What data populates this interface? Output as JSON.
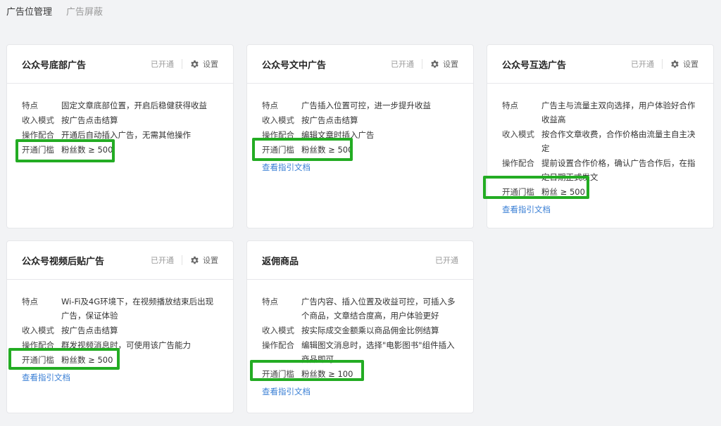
{
  "tabs": [
    {
      "label": "广告位管理"
    },
    {
      "label": "广告屏蔽"
    }
  ],
  "cards": [
    {
      "title": "公众号底部广告",
      "status": "已开通",
      "settings": "设置",
      "rows": [
        {
          "k": "特点",
          "v": "固定文章底部位置，开启后稳健获得收益"
        },
        {
          "k": "收入模式",
          "v": "按广告点击结算"
        },
        {
          "k": "操作配合",
          "v": "开通后自动插入广告，无需其他操作"
        },
        {
          "k": "开通门槛",
          "v": "粉丝数 ≥ 500"
        }
      ]
    },
    {
      "title": "公众号文中广告",
      "status": "已开通",
      "settings": "设置",
      "rows": [
        {
          "k": "特点",
          "v": "广告插入位置可控，进一步提升收益"
        },
        {
          "k": "收入模式",
          "v": "按广告点击结算"
        },
        {
          "k": "操作配合",
          "v": "编辑文章时插入广告"
        },
        {
          "k": "开通门槛",
          "v": "粉丝数 ≥ 500"
        }
      ],
      "guide": "查看指引文档"
    },
    {
      "title": "公众号互选广告",
      "status": "已开通",
      "settings": "设置",
      "rows": [
        {
          "k": "特点",
          "v": "广告主与流量主双向选择，用户体验好合作收益高"
        },
        {
          "k": "收入模式",
          "v": "按合作文章收费，合作价格由流量主自主决定"
        },
        {
          "k": "操作配合",
          "v": "提前设置合作价格，确认广告合作后，在指定日期正式发文"
        },
        {
          "k": "开通门槛",
          "v": "粉丝 ≥ 500"
        }
      ],
      "guide": "查看指引文档"
    },
    {
      "title": "公众号视频后贴广告",
      "status": "已开通",
      "settings": "设置",
      "rows": [
        {
          "k": "特点",
          "v": "Wi-Fi及4G环境下，在视频播放结束后出现广告，保证体验"
        },
        {
          "k": "收入模式",
          "v": "按广告点击结算"
        },
        {
          "k": "操作配合",
          "v": "群发视频消息时，可使用该广告能力"
        },
        {
          "k": "开通门槛",
          "v": "粉丝数 ≥ 500"
        }
      ],
      "guide": "查看指引文档"
    },
    {
      "title": "返佣商品",
      "status": "已开通",
      "rows": [
        {
          "k": "特点",
          "v": "广告内容、插入位置及收益可控，可插入多个商品，文章结合度高，用户体验更好"
        },
        {
          "k": "收入模式",
          "v": "按实际成交金额乘以商品佣金比例结算"
        },
        {
          "k": "操作配合",
          "v": "编辑图文消息时，选择\"电影图书\"组件插入商品即可"
        },
        {
          "k": "开通门槛",
          "v": "粉丝数 ≥ 100"
        }
      ],
      "guide": "查看指引文档"
    }
  ],
  "highlight_color": "#23ac23",
  "link_color": "#3a7fd5"
}
